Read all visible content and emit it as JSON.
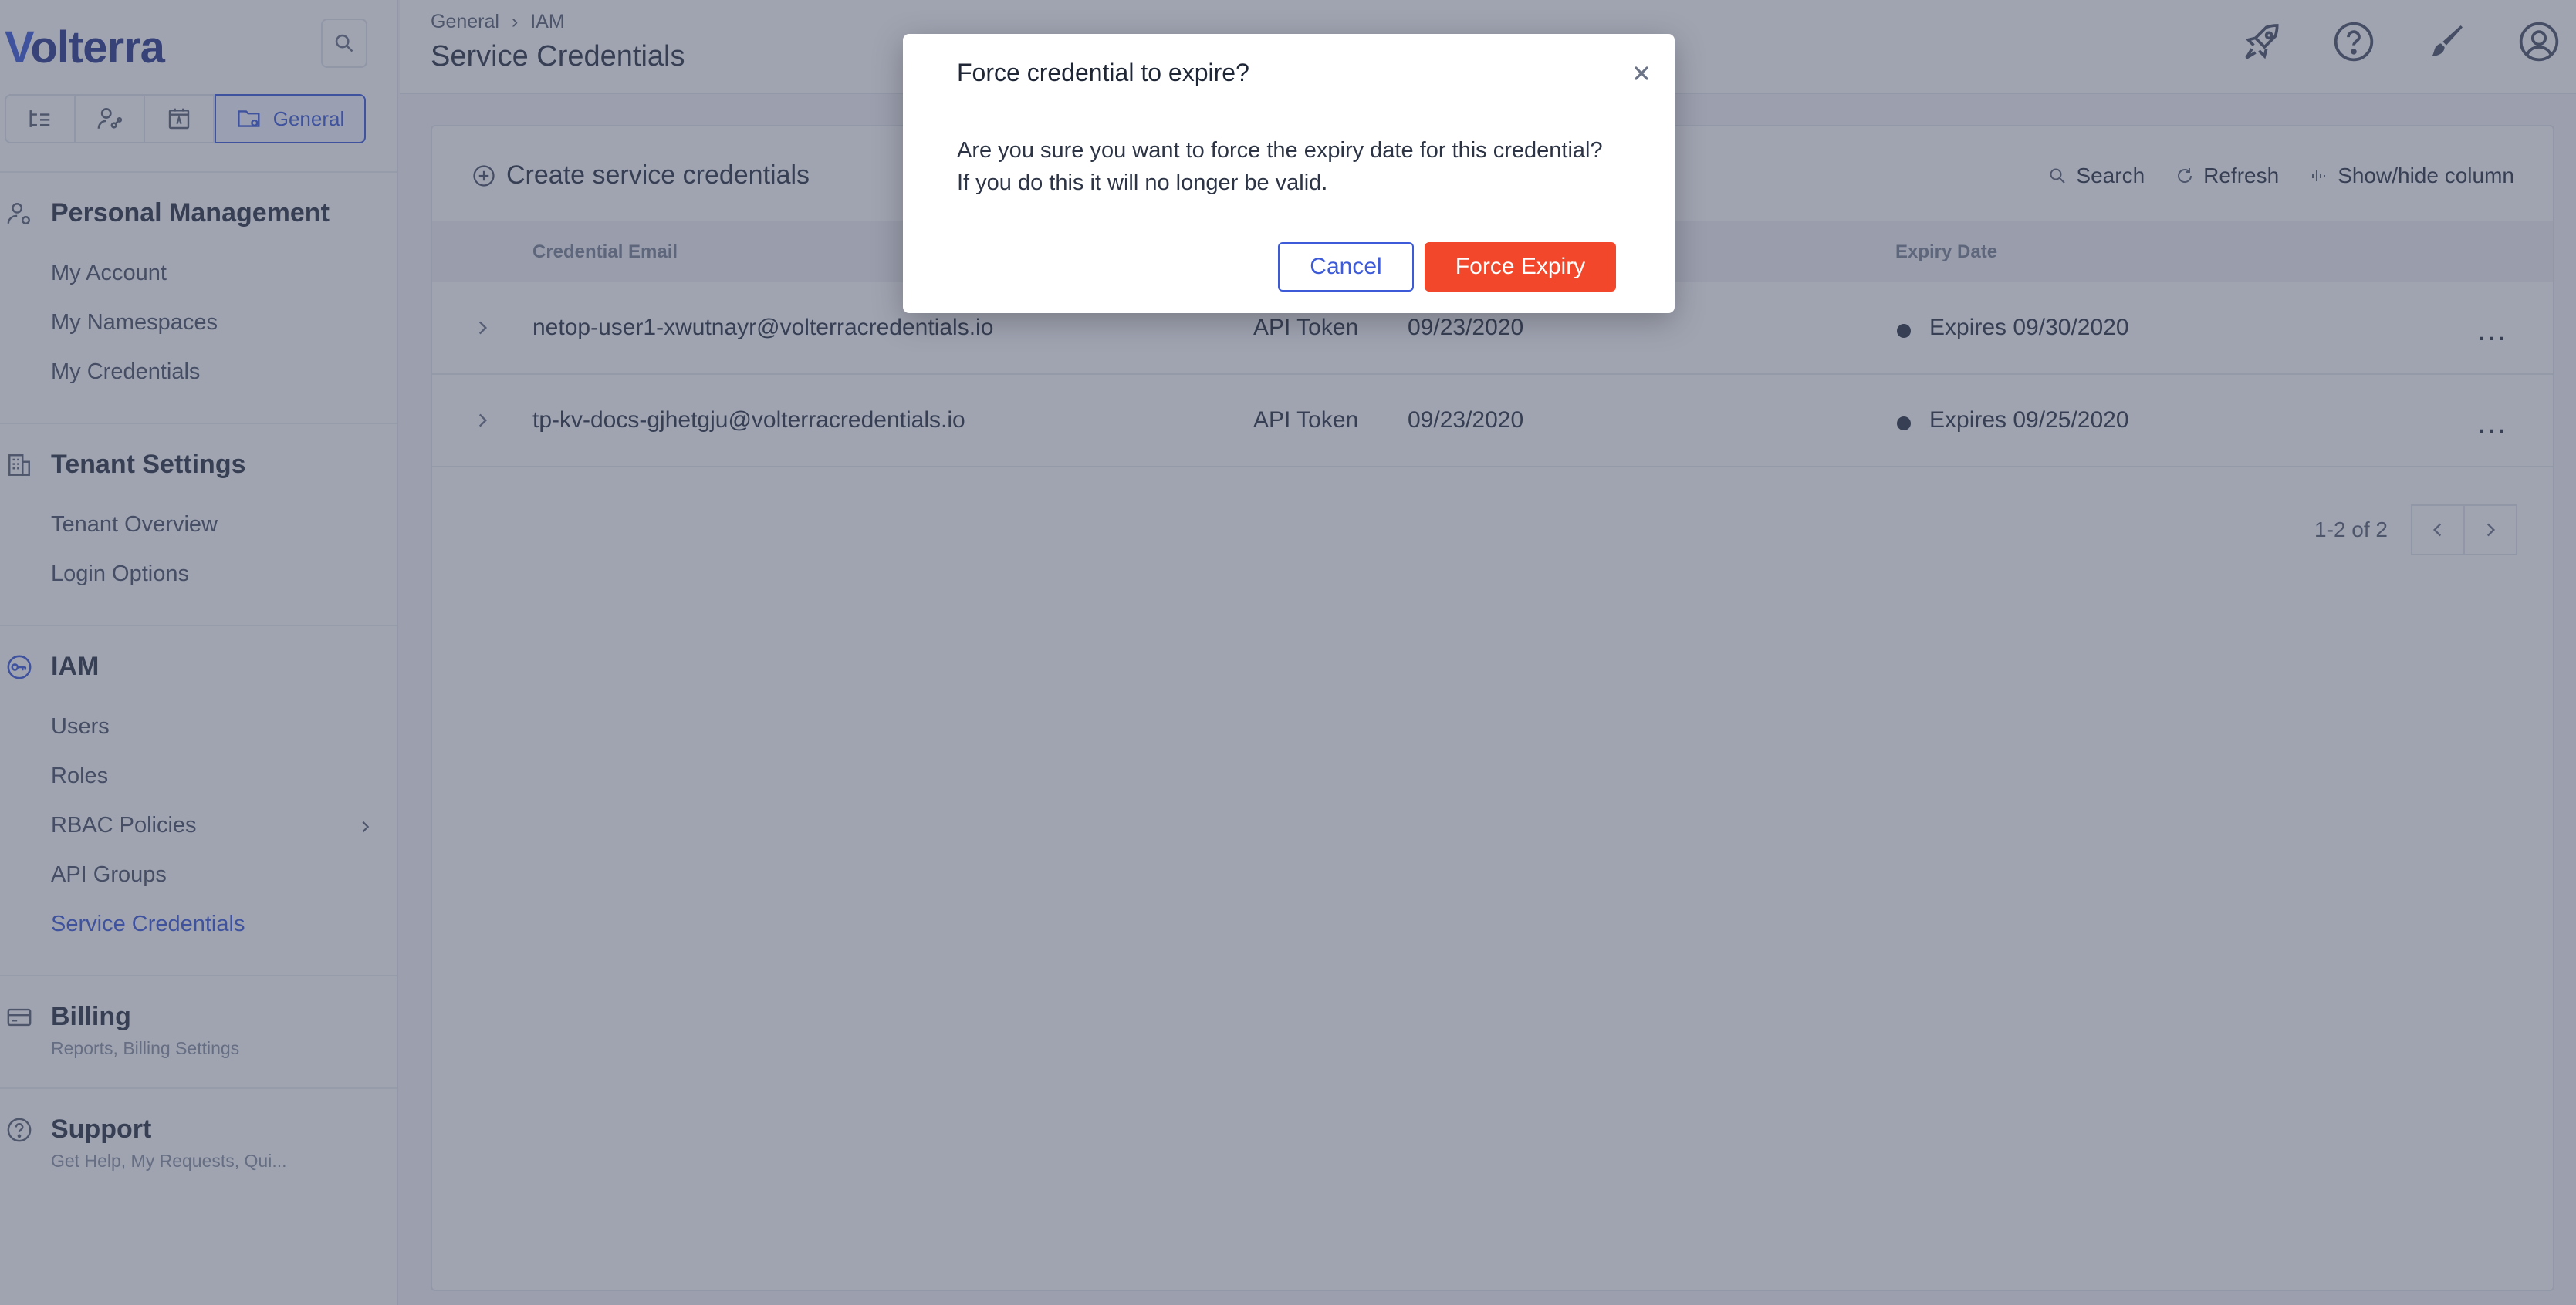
{
  "brand": {
    "logo_text": "olterra",
    "logo_letter": "V"
  },
  "context_tabs": {
    "active_label": "General"
  },
  "sidebar": {
    "personal": {
      "title": "Personal Management",
      "items": [
        "My Account",
        "My Namespaces",
        "My Credentials"
      ]
    },
    "tenant": {
      "title": "Tenant Settings",
      "items": [
        "Tenant Overview",
        "Login Options"
      ]
    },
    "iam": {
      "title": "IAM",
      "items": [
        "Users",
        "Roles",
        "RBAC Policies",
        "API Groups",
        "Service Credentials"
      ],
      "active": "Service Credentials"
    },
    "billing": {
      "title": "Billing",
      "desc": "Reports, Billing Settings"
    },
    "support": {
      "title": "Support",
      "desc": "Get Help, My Requests, Qui..."
    }
  },
  "header": {
    "breadcrumb": [
      "General",
      "IAM"
    ],
    "breadcrumb_sep": "›",
    "title": "Service Credentials"
  },
  "toolbar": {
    "create_label": "Create service credentials",
    "search_label": "Search",
    "refresh_label": "Refresh",
    "columns_label": "Show/hide column"
  },
  "table": {
    "columns": [
      "Credential Email",
      "Expiry Date"
    ],
    "rows": [
      {
        "email": "netop-user1-xwutnayr@volterracredentials.io",
        "type": "API Token",
        "created": "09/23/2020",
        "expiry": "Expires 09/30/2020"
      },
      {
        "email": "tp-kv-docs-gjhetgju@volterracredentials.io",
        "type": "API Token",
        "created": "09/23/2020",
        "expiry": "Expires 09/25/2020"
      }
    ],
    "more_label": "..."
  },
  "pagination": {
    "summary": "1-2 of 2"
  },
  "modal": {
    "title": "Force credential to expire?",
    "body": "Are you sure you want to force the expiry date for this credential? If you do this it will no longer be valid.",
    "cancel_label": "Cancel",
    "confirm_label": "Force Expiry"
  },
  "colors": {
    "accent": "#3d5bd9",
    "danger": "#f2472a",
    "overlay": "rgba(66,74,99,0.5)"
  }
}
